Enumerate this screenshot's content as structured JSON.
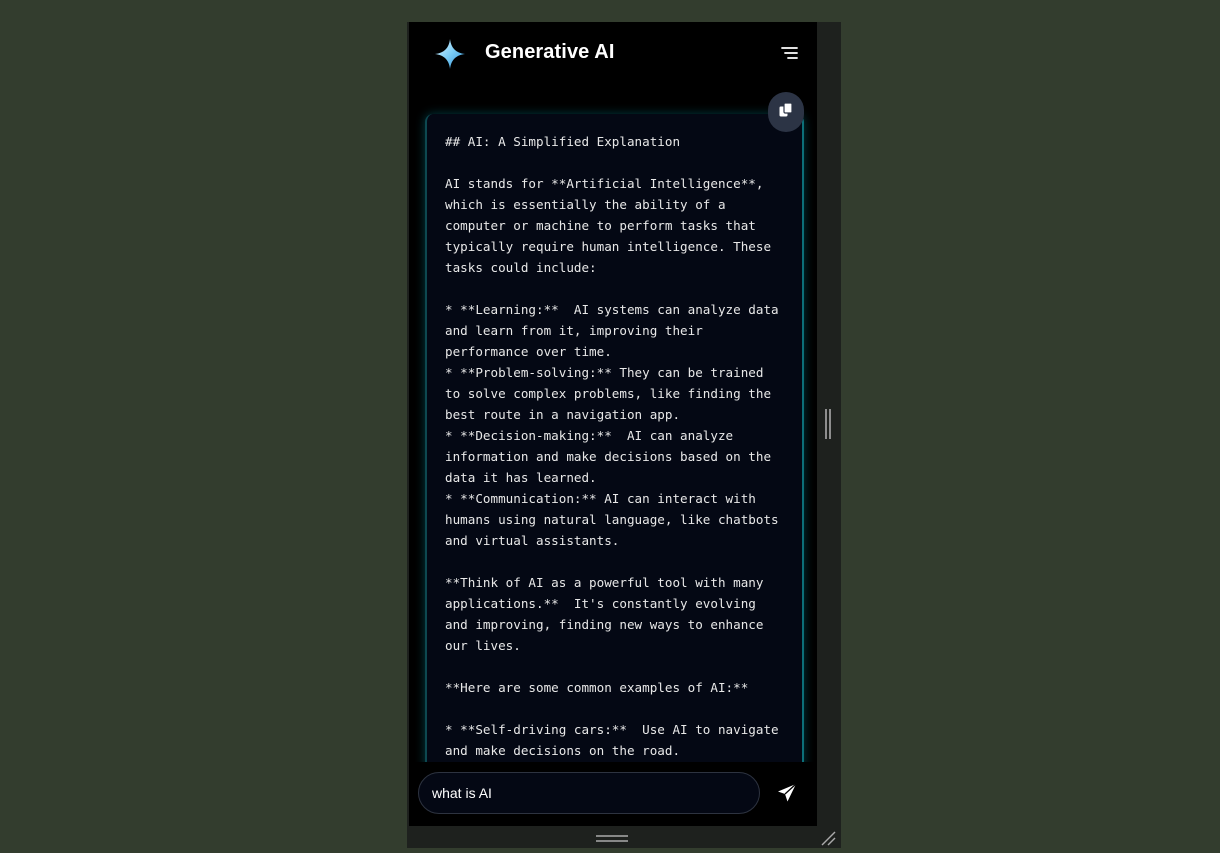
{
  "header": {
    "title": "Generative AI",
    "logo_icon": "sparkle-icon",
    "menu_icon": "menu-icon"
  },
  "response": {
    "copy_icon": "copy-icon",
    "text": "## AI: A Simplified Explanation\n\nAI stands for **Artificial Intelligence**, which is essentially the ability of a computer or machine to perform tasks that typically require human intelligence. These tasks could include:\n\n* **Learning:**  AI systems can analyze data and learn from it, improving their performance over time.\n* **Problem-solving:** They can be trained to solve complex problems, like finding the best route in a navigation app.\n* **Decision-making:**  AI can analyze information and make decisions based on the data it has learned.\n* **Communication:** AI can interact with humans using natural language, like chatbots and virtual assistants.\n\n**Think of AI as a powerful tool with many applications.**  It's constantly evolving and improving, finding new ways to enhance our lives.\n\n**Here are some common examples of AI:**\n\n* **Self-driving cars:**  Use AI to navigate and make decisions on the road."
  },
  "input": {
    "value": "what is AI",
    "send_icon": "send-icon"
  },
  "colors": {
    "background": "#333d2e",
    "app_background": "#000000",
    "card_background": "#040814",
    "accent": "#0c6f78"
  }
}
